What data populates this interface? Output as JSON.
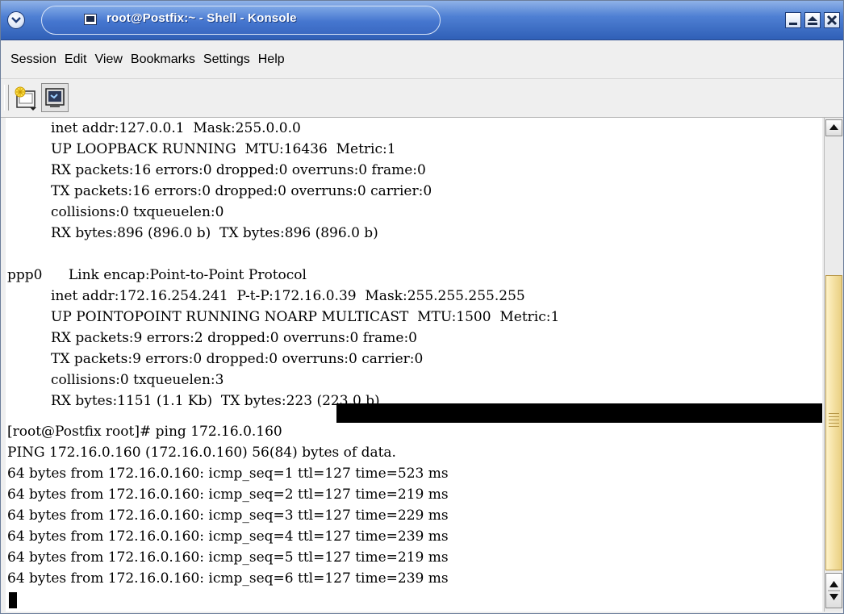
{
  "window": {
    "title": "root@Postfix:~ - Shell - Konsole"
  },
  "menubar": {
    "items": [
      "Session",
      "Edit",
      "View",
      "Bookmarks",
      "Settings",
      "Help"
    ]
  },
  "toolbar": {
    "buttons": [
      "new-session-icon",
      "konsole-icon"
    ]
  },
  "terminal": {
    "lines": [
      "          inet addr:127.0.0.1  Mask:255.0.0.0",
      "          UP LOOPBACK RUNNING  MTU:16436  Metric:1",
      "          RX packets:16 errors:0 dropped:0 overruns:0 frame:0",
      "          TX packets:16 errors:0 dropped:0 overruns:0 carrier:0",
      "          collisions:0 txqueuelen:0",
      "          RX bytes:896 (896.0 b)  TX bytes:896 (896.0 b)",
      "",
      "ppp0      Link encap:Point-to-Point Protocol",
      "          inet addr:172.16.254.241  P-t-P:172.16.0.39  Mask:255.255.255.255",
      "          UP POINTOPOINT RUNNING NOARP MULTICAST  MTU:1500  Metric:1",
      "          RX packets:9 errors:2 dropped:0 overruns:0 frame:0",
      "          TX packets:9 errors:0 dropped:0 overruns:0 carrier:0",
      "          collisions:0 txqueuelen:3",
      "          RX bytes:1151 (1.1 Kb)  TX bytes:223 (223.0 b)",
      "",
      "[root@Postfix root]# ping 172.16.0.160",
      "PING 172.16.0.160 (172.16.0.160) 56(84) bytes of data.",
      "64 bytes from 172.16.0.160: icmp_seq=1 ttl=127 time=523 ms",
      "64 bytes from 172.16.0.160: icmp_seq=2 ttl=127 time=219 ms",
      "64 bytes from 172.16.0.160: icmp_seq=3 ttl=127 time=229 ms",
      "64 bytes from 172.16.0.160: icmp_seq=4 ttl=127 time=239 ms",
      "64 bytes from 172.16.0.160: icmp_seq=5 ttl=127 time=219 ms",
      "64 bytes from 172.16.0.160: icmp_seq=6 ttl=127 time=239 ms"
    ]
  },
  "colors": {
    "titlebar": "#4f80d3",
    "scroll_thumb": "#f4e0a2",
    "terminal_bg": "#ffffff",
    "terminal_fg": "#000000"
  }
}
